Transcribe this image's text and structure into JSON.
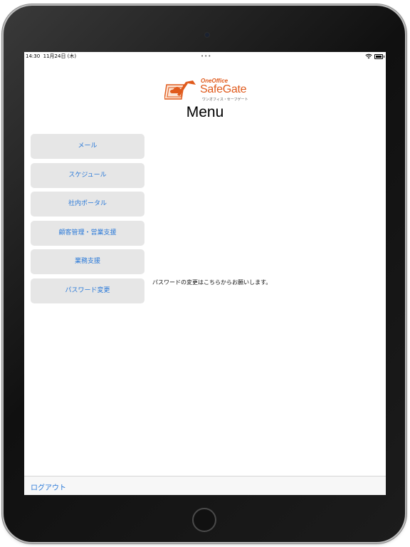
{
  "status_bar": {
    "time": "14:30",
    "date": "11月24日 (木)",
    "dots": "•••"
  },
  "logo": {
    "brand_top": "OneOffice",
    "brand": "SafeGate",
    "subtitle": "ワンオフィス・セーフゲート",
    "color": "#e05a1c"
  },
  "page": {
    "title": "Menu"
  },
  "menu": {
    "items": [
      {
        "label": "メール"
      },
      {
        "label": "スケジュール"
      },
      {
        "label": "社内ポータル"
      },
      {
        "label": "顧客管理・営業支援"
      },
      {
        "label": "業務支援"
      },
      {
        "label": "パスワード変更"
      }
    ]
  },
  "hint": {
    "password_change": "パスワードの変更はこちらからお願いします。"
  },
  "toolbar": {
    "logout_label": "ログアウト"
  },
  "colors": {
    "link": "#2a79d8",
    "button_bg": "#e6e6e6"
  }
}
